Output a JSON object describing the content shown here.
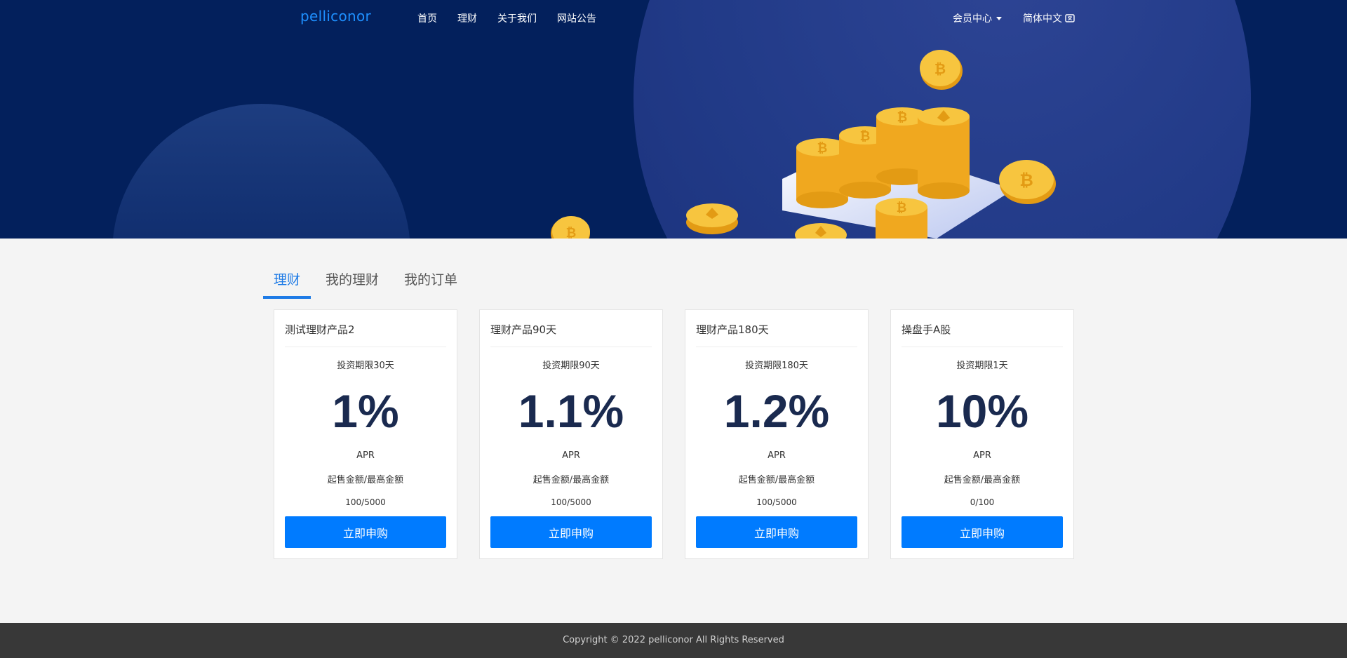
{
  "nav": {
    "logo": "pelliconor",
    "links": [
      "首页",
      "理财",
      "关于我们",
      "网站公告"
    ],
    "member_center": "会员中心",
    "language": "简体中文"
  },
  "tabs": [
    "理财",
    "我的理财",
    "我的订单"
  ],
  "products": [
    {
      "title": "测试理财产品2",
      "term": "投资期限30天",
      "rate": "1%",
      "apr": "APR",
      "range_label": "起售金额/最高金额",
      "range": "100/5000",
      "button": "立即申购"
    },
    {
      "title": "理财产品90天",
      "term": "投资期限90天",
      "rate": "1.1%",
      "apr": "APR",
      "range_label": "起售金额/最高金额",
      "range": "100/5000",
      "button": "立即申购"
    },
    {
      "title": "理财产品180天",
      "term": "投资期限180天",
      "rate": "1.2%",
      "apr": "APR",
      "range_label": "起售金额/最高金额",
      "range": "100/5000",
      "button": "立即申购"
    },
    {
      "title": "操盘手A股",
      "term": "投资期限1天",
      "rate": "10%",
      "apr": "APR",
      "range_label": "起售金额/最高金额",
      "range": "0/100",
      "button": "立即申购"
    }
  ],
  "footer": {
    "copyright": "Copyright © 2022 pelliconor All Rights Reserved"
  },
  "colors": {
    "hero_bg": "#03205c",
    "accent": "#007bff",
    "coin": "#f5b82e",
    "footer_bg": "#383838"
  },
  "icons": [
    "caret-down-icon",
    "translate-icon",
    "bitcoin-coin-icon",
    "ethereum-coin-icon"
  ]
}
